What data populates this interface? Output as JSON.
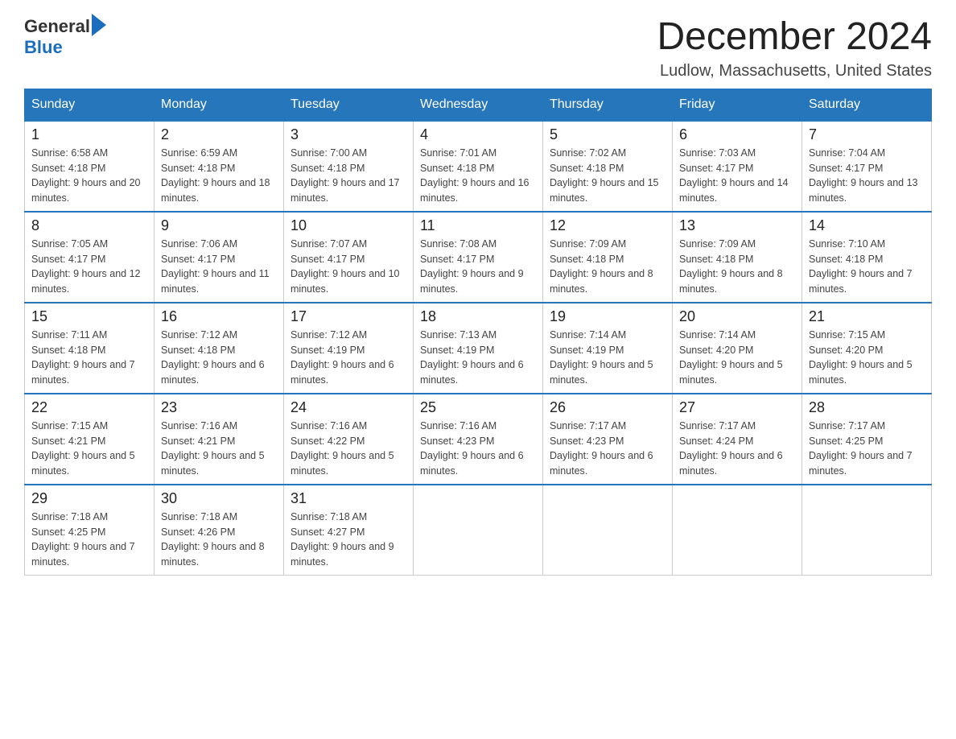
{
  "header": {
    "logo_text_general": "General",
    "logo_text_blue": "Blue",
    "month_title": "December 2024",
    "location": "Ludlow, Massachusetts, United States"
  },
  "weekdays": [
    "Sunday",
    "Monday",
    "Tuesday",
    "Wednesday",
    "Thursday",
    "Friday",
    "Saturday"
  ],
  "weeks": [
    [
      {
        "day": "1",
        "sunrise": "6:58 AM",
        "sunset": "4:18 PM",
        "daylight": "9 hours and 20 minutes."
      },
      {
        "day": "2",
        "sunrise": "6:59 AM",
        "sunset": "4:18 PM",
        "daylight": "9 hours and 18 minutes."
      },
      {
        "day": "3",
        "sunrise": "7:00 AM",
        "sunset": "4:18 PM",
        "daylight": "9 hours and 17 minutes."
      },
      {
        "day": "4",
        "sunrise": "7:01 AM",
        "sunset": "4:18 PM",
        "daylight": "9 hours and 16 minutes."
      },
      {
        "day": "5",
        "sunrise": "7:02 AM",
        "sunset": "4:18 PM",
        "daylight": "9 hours and 15 minutes."
      },
      {
        "day": "6",
        "sunrise": "7:03 AM",
        "sunset": "4:17 PM",
        "daylight": "9 hours and 14 minutes."
      },
      {
        "day": "7",
        "sunrise": "7:04 AM",
        "sunset": "4:17 PM",
        "daylight": "9 hours and 13 minutes."
      }
    ],
    [
      {
        "day": "8",
        "sunrise": "7:05 AM",
        "sunset": "4:17 PM",
        "daylight": "9 hours and 12 minutes."
      },
      {
        "day": "9",
        "sunrise": "7:06 AM",
        "sunset": "4:17 PM",
        "daylight": "9 hours and 11 minutes."
      },
      {
        "day": "10",
        "sunrise": "7:07 AM",
        "sunset": "4:17 PM",
        "daylight": "9 hours and 10 minutes."
      },
      {
        "day": "11",
        "sunrise": "7:08 AM",
        "sunset": "4:17 PM",
        "daylight": "9 hours and 9 minutes."
      },
      {
        "day": "12",
        "sunrise": "7:09 AM",
        "sunset": "4:18 PM",
        "daylight": "9 hours and 8 minutes."
      },
      {
        "day": "13",
        "sunrise": "7:09 AM",
        "sunset": "4:18 PM",
        "daylight": "9 hours and 8 minutes."
      },
      {
        "day": "14",
        "sunrise": "7:10 AM",
        "sunset": "4:18 PM",
        "daylight": "9 hours and 7 minutes."
      }
    ],
    [
      {
        "day": "15",
        "sunrise": "7:11 AM",
        "sunset": "4:18 PM",
        "daylight": "9 hours and 7 minutes."
      },
      {
        "day": "16",
        "sunrise": "7:12 AM",
        "sunset": "4:18 PM",
        "daylight": "9 hours and 6 minutes."
      },
      {
        "day": "17",
        "sunrise": "7:12 AM",
        "sunset": "4:19 PM",
        "daylight": "9 hours and 6 minutes."
      },
      {
        "day": "18",
        "sunrise": "7:13 AM",
        "sunset": "4:19 PM",
        "daylight": "9 hours and 6 minutes."
      },
      {
        "day": "19",
        "sunrise": "7:14 AM",
        "sunset": "4:19 PM",
        "daylight": "9 hours and 5 minutes."
      },
      {
        "day": "20",
        "sunrise": "7:14 AM",
        "sunset": "4:20 PM",
        "daylight": "9 hours and 5 minutes."
      },
      {
        "day": "21",
        "sunrise": "7:15 AM",
        "sunset": "4:20 PM",
        "daylight": "9 hours and 5 minutes."
      }
    ],
    [
      {
        "day": "22",
        "sunrise": "7:15 AM",
        "sunset": "4:21 PM",
        "daylight": "9 hours and 5 minutes."
      },
      {
        "day": "23",
        "sunrise": "7:16 AM",
        "sunset": "4:21 PM",
        "daylight": "9 hours and 5 minutes."
      },
      {
        "day": "24",
        "sunrise": "7:16 AM",
        "sunset": "4:22 PM",
        "daylight": "9 hours and 5 minutes."
      },
      {
        "day": "25",
        "sunrise": "7:16 AM",
        "sunset": "4:23 PM",
        "daylight": "9 hours and 6 minutes."
      },
      {
        "day": "26",
        "sunrise": "7:17 AM",
        "sunset": "4:23 PM",
        "daylight": "9 hours and 6 minutes."
      },
      {
        "day": "27",
        "sunrise": "7:17 AM",
        "sunset": "4:24 PM",
        "daylight": "9 hours and 6 minutes."
      },
      {
        "day": "28",
        "sunrise": "7:17 AM",
        "sunset": "4:25 PM",
        "daylight": "9 hours and 7 minutes."
      }
    ],
    [
      {
        "day": "29",
        "sunrise": "7:18 AM",
        "sunset": "4:25 PM",
        "daylight": "9 hours and 7 minutes."
      },
      {
        "day": "30",
        "sunrise": "7:18 AM",
        "sunset": "4:26 PM",
        "daylight": "9 hours and 8 minutes."
      },
      {
        "day": "31",
        "sunrise": "7:18 AM",
        "sunset": "4:27 PM",
        "daylight": "9 hours and 9 minutes."
      },
      null,
      null,
      null,
      null
    ]
  ]
}
